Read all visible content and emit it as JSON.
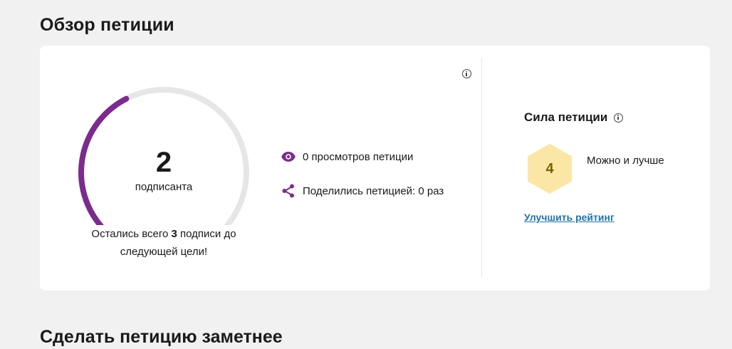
{
  "overview": {
    "title": "Обзор петиции"
  },
  "gauge": {
    "count": "2",
    "unit_label": "подписанта",
    "progress_fraction": 0.4,
    "track_color": "#e6e6e6",
    "fill_color": "#7b2c8e"
  },
  "goal": {
    "prefix": "Остались всего ",
    "remaining": "3",
    "suffix": " подписи до следующей цели!"
  },
  "stats": {
    "views_text": "0 просмотров петиции",
    "views_icon": "eye-icon",
    "shares_text": "Поделились петицией: 0 раз",
    "shares_icon": "share-icon",
    "icon_color": "#7b2c8e"
  },
  "strength": {
    "title": "Сила петиции",
    "score": "4",
    "rating_label": "Можно и лучше",
    "hex_color": "#fbe7a5",
    "improve_link": "Улучшить рейтинг",
    "link_color": "#2172a8"
  },
  "next_section": {
    "title": "Сделать петицию заметнее"
  }
}
